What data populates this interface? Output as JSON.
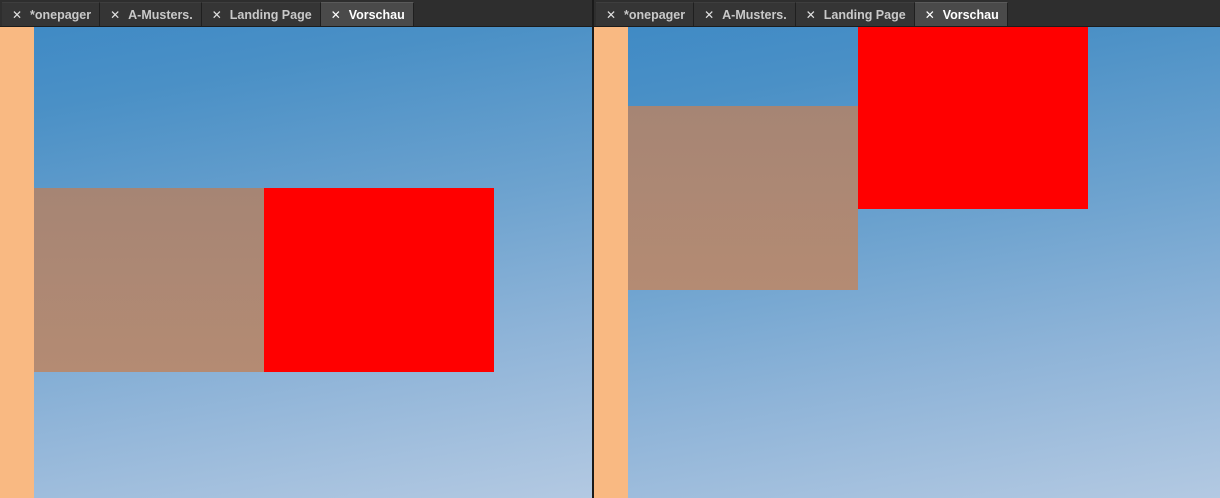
{
  "panes": [
    {
      "tabs": [
        {
          "label": "*onepager",
          "active": false
        },
        {
          "label": "A-Musters.",
          "active": false
        },
        {
          "label": "Landing Page",
          "active": false
        },
        {
          "label": "Vorschau",
          "active": true
        }
      ]
    },
    {
      "tabs": [
        {
          "label": "*onepager",
          "active": false
        },
        {
          "label": "A-Musters.",
          "active": false
        },
        {
          "label": "Landing Page",
          "active": false
        },
        {
          "label": "Vorschau",
          "active": true
        }
      ]
    }
  ],
  "icons": {
    "close": "close-icon"
  },
  "close_glyph": "✕",
  "colors": {
    "strip": "#f9b982",
    "brown_box": "#ad8873",
    "red_box": "#ff0000",
    "sky_top": "#3f8ac5",
    "sky_bottom": "#b3c9e2"
  }
}
